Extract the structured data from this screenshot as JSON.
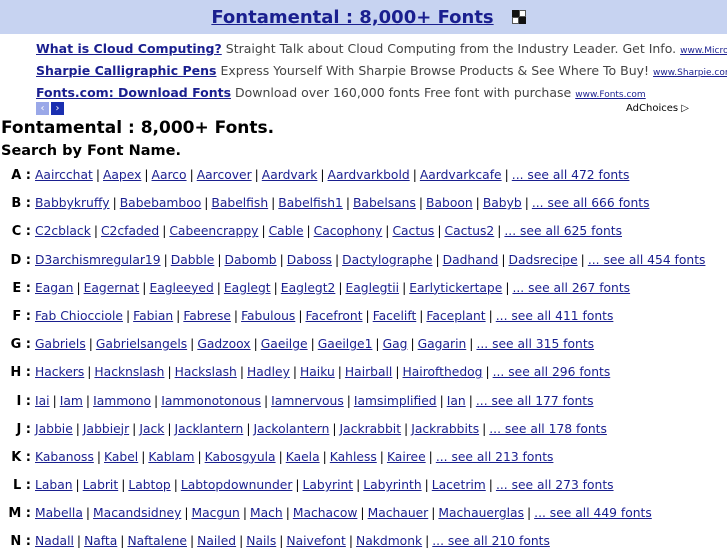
{
  "header": {
    "title": "Fontamental : 8,000+ Fonts",
    "logo_icon": "checker-logo-icon"
  },
  "ads": [
    {
      "title": "What is Cloud Computing?",
      "desc": "Straight Talk about Cloud Computing from the Industry Leader. Get Info.",
      "url": "www.Microso"
    },
    {
      "title": "Sharpie Calligraphic Pens",
      "desc": "Express Yourself With Sharpie Browse Products & See Where To Buy!",
      "url": "www.Sharpie.com"
    },
    {
      "title": "Fonts.com: Download Fonts",
      "desc": "Download over 160,000 fonts Free font with purchase",
      "url": "www.Fonts.com"
    }
  ],
  "ad_nav": {
    "prev": "‹",
    "next": "›"
  },
  "adchoices": "AdChoices ▷",
  "main_heading": "Fontamental : 8,000+ Fonts.",
  "sub_heading": "Search by Font Name.",
  "letters": [
    {
      "letter": "A :",
      "fonts": [
        "Aaircchat",
        "Aapex",
        "Aarco",
        "Aarcover",
        "Aardvark",
        "Aardvarkbold",
        "Aardvarkcafe"
      ],
      "see_all": "... see all 472 fonts"
    },
    {
      "letter": "B :",
      "fonts": [
        "Babbykruffy",
        "Babebamboo",
        "Babelfish",
        "Babelfish1",
        "Babelsans",
        "Baboon",
        "Babyb"
      ],
      "see_all": "... see all 666 fonts"
    },
    {
      "letter": "C :",
      "fonts": [
        "C2cblack",
        "C2cfaded",
        "Cabeencrappy",
        "Cable",
        "Cacophony",
        "Cactus",
        "Cactus2"
      ],
      "see_all": "... see all 625 fonts"
    },
    {
      "letter": "D :",
      "fonts": [
        "D3archismregular19",
        "Dabble",
        "Dabomb",
        "Daboss",
        "Dactylographe",
        "Dadhand",
        "Dadsrecipe"
      ],
      "see_all": "... see all 454 fonts"
    },
    {
      "letter": "E :",
      "fonts": [
        "Eagan",
        "Eagernat",
        "Eagleeyed",
        "Eaglegt",
        "Eaglegt2",
        "Eaglegtii",
        "Earlytickertape"
      ],
      "see_all": "... see all 267 fonts"
    },
    {
      "letter": "F :",
      "fonts": [
        "Fab Chiocciole",
        "Fabian",
        "Fabrese",
        "Fabulous",
        "Facefront",
        "Facelift",
        "Faceplant"
      ],
      "see_all": "... see all 411 fonts"
    },
    {
      "letter": "G :",
      "fonts": [
        "Gabriels",
        "Gabrielsangels",
        "Gadzoox",
        "Gaeilge",
        "Gaeilge1",
        "Gag",
        "Gagarin"
      ],
      "see_all": "... see all 315 fonts"
    },
    {
      "letter": "H :",
      "fonts": [
        "Hackers",
        "Hacknslash",
        "Hackslash",
        "Hadley",
        "Haiku",
        "Hairball",
        "Hairofthedog"
      ],
      "see_all": "... see all 296 fonts"
    },
    {
      "letter": "I :",
      "fonts": [
        "Iai",
        "Iam",
        "Iammono",
        "Iammonotonous",
        "Iamnervous",
        "Iamsimplified",
        "Ian"
      ],
      "see_all": "... see all 177 fonts"
    },
    {
      "letter": "J :",
      "fonts": [
        "Jabbie",
        "Jabbiejr",
        "Jack",
        "Jacklantern",
        "Jackolantern",
        "Jackrabbit",
        "Jackrabbits"
      ],
      "see_all": "... see all 178 fonts"
    },
    {
      "letter": "K :",
      "fonts": [
        "Kabanoss",
        "Kabel",
        "Kablam",
        "Kabosgyula",
        "Kaela",
        "Kahless",
        "Kairee"
      ],
      "see_all": "... see all 213 fonts"
    },
    {
      "letter": "L :",
      "fonts": [
        "Laban",
        "Labrit",
        "Labtop",
        "Labtopdownunder",
        "Labyrint",
        "Labyrinth",
        "Lacetrim"
      ],
      "see_all": "... see all 273 fonts"
    },
    {
      "letter": "M :",
      "fonts": [
        "Mabella",
        "Macandsidney",
        "Macgun",
        "Mach",
        "Machacow",
        "Machauer",
        "Machauerglas"
      ],
      "see_all": "... see all 449 fonts"
    },
    {
      "letter": "N :",
      "fonts": [
        "Nadall",
        "Nafta",
        "Naftalene",
        "Nailed",
        "Nails",
        "Naivefont",
        "Nakdmonk"
      ],
      "see_all": "... see all 210 fonts"
    }
  ],
  "colors": {
    "header_bg": "#c7d3f1",
    "link": "#1a1f8f",
    "nav_btn": "#1a2fb0"
  }
}
